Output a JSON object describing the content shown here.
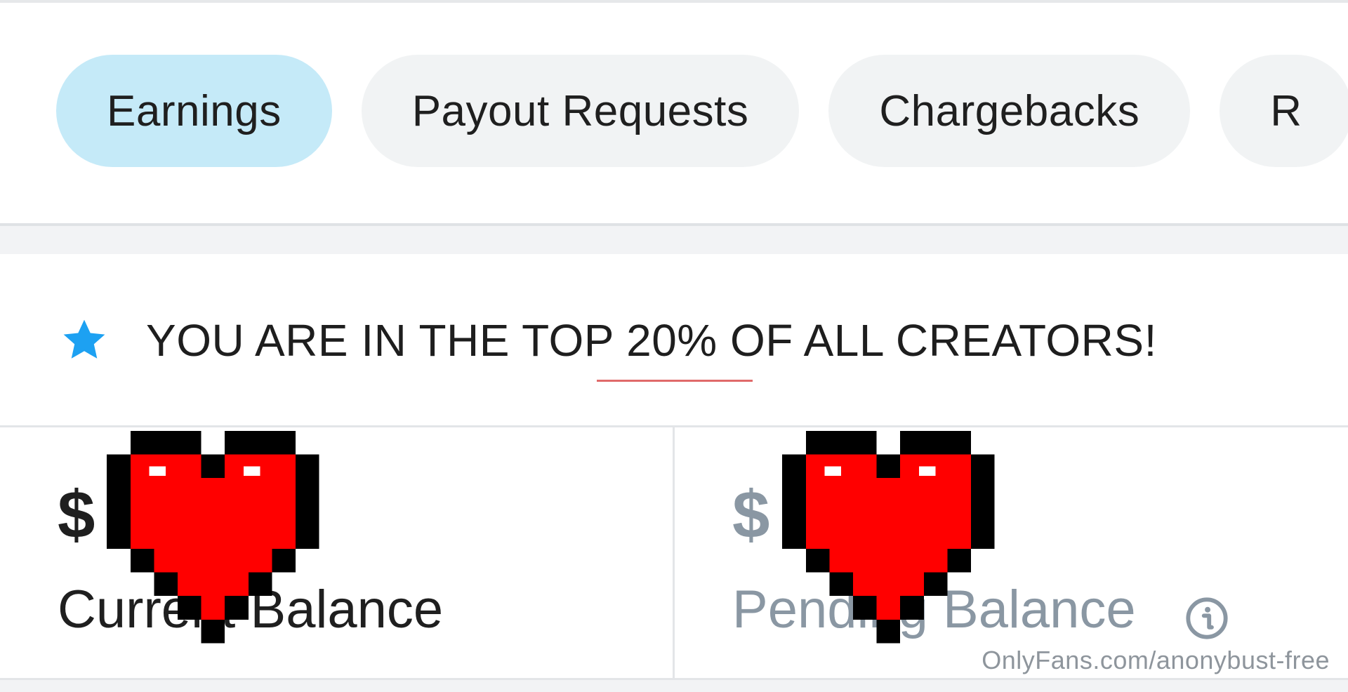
{
  "tabs": [
    {
      "label": "Earnings",
      "active": true
    },
    {
      "label": "Payout Requests",
      "active": false
    },
    {
      "label": "Chargebacks",
      "active": false
    },
    {
      "label": "R",
      "active": false
    }
  ],
  "banner": {
    "icon": "star-icon",
    "text": "YOU ARE IN THE TOP 20% OF ALL CREATORS!"
  },
  "balances": {
    "current": {
      "amount_prefix": "$",
      "label": "Current Balance",
      "label_visible": "Curre   alance"
    },
    "pending": {
      "amount_prefix": "$",
      "label": "Pending Balance",
      "label_visible": "Pend    alance",
      "info_icon": "info-icon"
    }
  },
  "overlays": {
    "censor_icon": "pixel-heart-icon"
  },
  "watermark": "OnlyFans.com/anonybust-free",
  "colors": {
    "active_tab": "#c5eaf8",
    "inactive_tab": "#f1f3f4",
    "star": "#1da1f2",
    "muted_text": "#8a97a3",
    "heart_red": "#ff0000"
  }
}
